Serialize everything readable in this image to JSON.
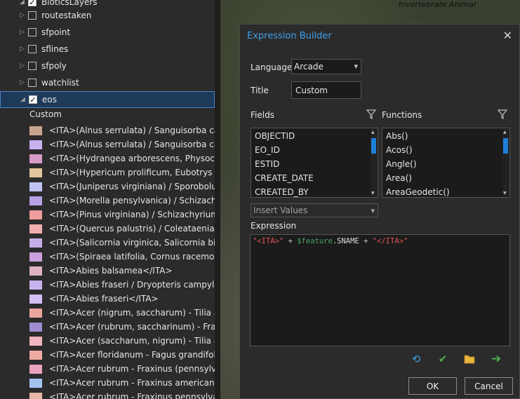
{
  "map": {
    "label": "Invertebrate Animal"
  },
  "contents": {
    "top_partial": "BioticsLayers",
    "layers": [
      {
        "label": "routestaken",
        "checked": false
      },
      {
        "label": "sfpoint",
        "checked": false
      },
      {
        "label": "sflines",
        "checked": false
      },
      {
        "label": "sfpoly",
        "checked": false
      },
      {
        "label": "watchlist",
        "checked": false
      },
      {
        "label": "eos",
        "checked": true
      }
    ],
    "custom_heading": "Custom",
    "symbols": [
      {
        "label": "<ITA>(Alnus serrulata) / Sanguisorba canade",
        "color": "#c9a48c"
      },
      {
        "label": "<ITA>(Alnus serrulata) / Sanguisorba canade",
        "color": "#c9b0ee"
      },
      {
        "label": "<ITA>(Hydrangea arborescens, Physocarpus",
        "color": "#d79cc6"
      },
      {
        "label": "<ITA>(Hypericum prolificum, Eubotrys racen",
        "color": "#e2c59c"
      },
      {
        "label": "<ITA>(Juniperus virginiana) / Sporobolus vag",
        "color": "#c2c2f2"
      },
      {
        "label": "<ITA>(Morella pensylvanica) / Schizachyriun",
        "color": "#b8a2e4"
      },
      {
        "label": "<ITA>(Pinus virginiana) / Schizachyrium sco",
        "color": "#ee9c9c"
      },
      {
        "label": "<ITA>(Quercus palustris) / Coleataenia rigidu",
        "color": "#f0aeae"
      },
      {
        "label": "<ITA>(Salicornia virginica, Salicornia bigelov",
        "color": "#c3aee8"
      },
      {
        "label": "<ITA>(Spiraea latifolia, Cornus racemosa) / C",
        "color": "#cca0dc"
      },
      {
        "label": "<ITA>Abies balsamea</ITA>",
        "color": "#e0b2c0"
      },
      {
        "label": "<ITA>Abies fraseri / Dryopteris campyloptera",
        "color": "#c7b4ee"
      },
      {
        "label": "<ITA>Abies fraseri</ITA>",
        "color": "#d2c0f4"
      },
      {
        "label": "<ITA>Acer (nigrum, saccharum) - Tilia amer",
        "color": "#eaa69e"
      },
      {
        "label": "<ITA>Acer (rubrum, saccharinum) - Fraxinus",
        "color": "#a08cd0"
      },
      {
        "label": "<ITA>Acer (saccharum, nigrum) - Tilia amer",
        "color": "#f2b4c0"
      },
      {
        "label": "<ITA>Acer floridanum - Fagus grandifolia - (",
        "color": "#f0aaa4"
      },
      {
        "label": "<ITA>Acer rubrum - Fraxinus (pennsylvanica",
        "color": "#eaa2c0"
      },
      {
        "label": "<ITA>Acer rubrum - Fraxinus americana - Fra",
        "color": "#a4c4f0"
      },
      {
        "label": "<ITA>Acer rubrum - Fraxinus pennsylvanica",
        "color": "#e8b8a8"
      }
    ]
  },
  "dialog": {
    "title": "Expression Builder",
    "language_label": "Language",
    "language_value": "Arcade",
    "title_label": "Title",
    "title_value": "Custom",
    "fields_label": "Fields",
    "functions_label": "Functions",
    "fields": [
      "OBJECTID",
      "EO_ID",
      "ESTID",
      "CREATE_DATE",
      "CREATED_BY"
    ],
    "functions": [
      "Abs()",
      "Acos()",
      "Angle()",
      "Area()",
      "AreaGeodetic()"
    ],
    "insert_values_placeholder": "Insert Values",
    "expression_label": "Expression",
    "expression": {
      "str1": "\"<ITA>\"",
      "op1": " + ",
      "var": "$feature",
      "prop": ".SNAME",
      "op2": " + ",
      "str2": "\"</ITA>\""
    },
    "ok_label": "OK",
    "cancel_label": "Cancel"
  }
}
